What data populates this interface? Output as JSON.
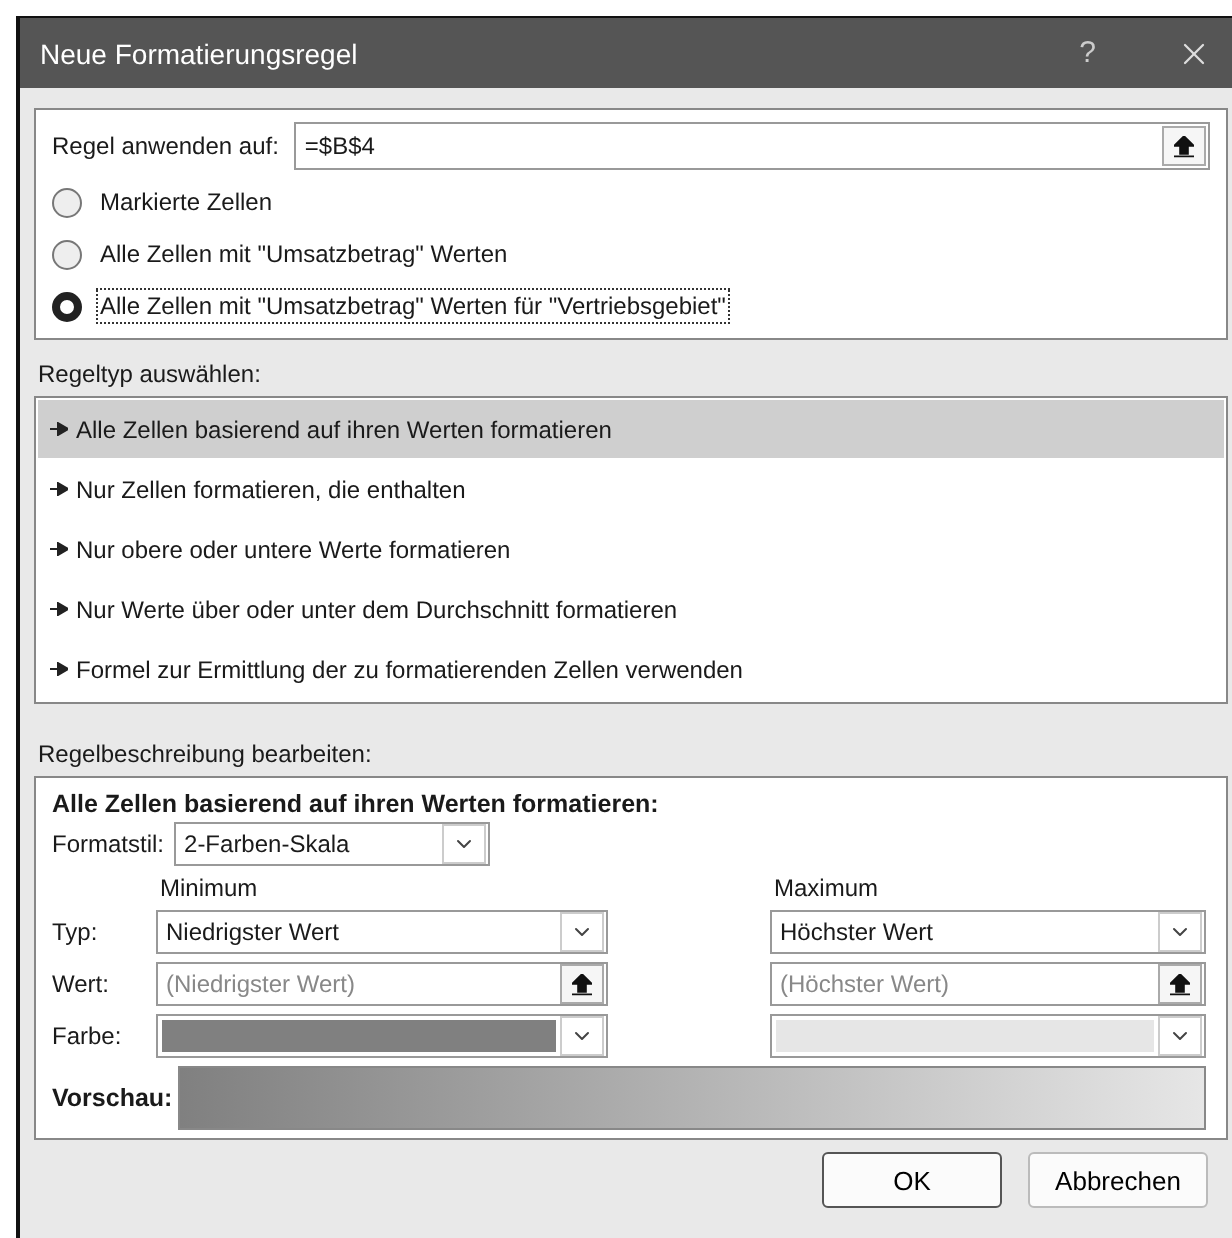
{
  "window": {
    "title": "Neue Formatierungsregel",
    "help_label": "?"
  },
  "apply_to": {
    "label": "Regel anwenden auf:",
    "value": "=$B$4"
  },
  "scope_options": [
    {
      "label": "Markierte Zellen",
      "selected": false
    },
    {
      "label": "Alle Zellen mit \"Umsatzbetrag\" Werten",
      "selected": false
    },
    {
      "label": "Alle Zellen mit \"Umsatzbetrag\" Werten für \"Vertriebsgebiet\"",
      "selected": true
    }
  ],
  "rule_types": {
    "label": "Regeltyp auswählen:",
    "items": [
      {
        "label": "Alle Zellen basierend auf ihren Werten formatieren",
        "selected": true
      },
      {
        "label": "Nur Zellen formatieren, die enthalten",
        "selected": false
      },
      {
        "label": "Nur obere oder untere Werte formatieren",
        "selected": false
      },
      {
        "label": "Nur Werte über oder unter dem Durchschnitt formatieren",
        "selected": false
      },
      {
        "label": "Formel zur Ermittlung der zu formatierenden Zellen verwenden",
        "selected": false
      }
    ]
  },
  "description": {
    "label": "Regelbeschreibung bearbeiten:",
    "heading": "Alle Zellen basierend auf ihren Werten formatieren:",
    "style_label": "Formatstil:",
    "style_value": "2-Farben-Skala",
    "row_labels": [
      "Typ:",
      "Wert:",
      "Farbe:"
    ],
    "columns": [
      {
        "header": "Minimum",
        "type": "Niedrigster Wert",
        "value_placeholder": "(Niedrigster Wert)",
        "color": "#808080"
      },
      {
        "header": "Maximum",
        "type": "Höchster Wert",
        "value_placeholder": "(Höchster Wert)",
        "color": "#e6e6e6"
      }
    ],
    "preview_label": "Vorschau:"
  },
  "buttons": [
    {
      "label": "OK",
      "default": true
    },
    {
      "label": "Abbrechen",
      "default": false
    }
  ]
}
